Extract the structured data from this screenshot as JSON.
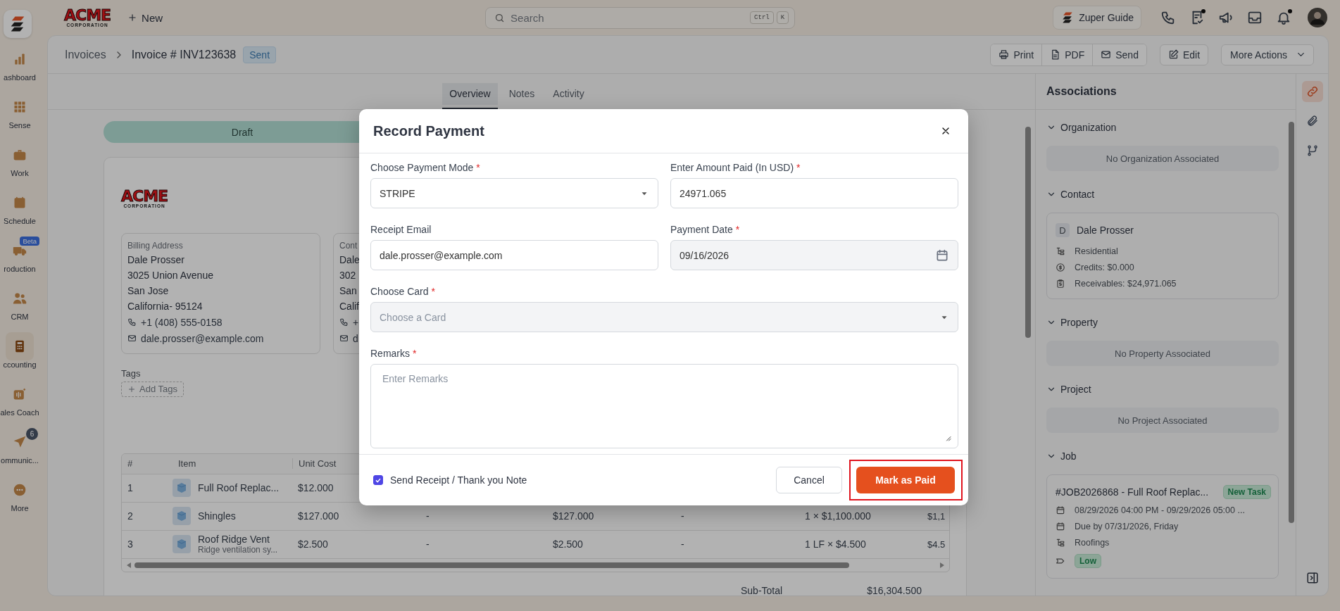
{
  "rail": {
    "items": [
      {
        "label": "ashboard",
        "selected": false
      },
      {
        "label": "Sense",
        "selected": false
      },
      {
        "label": "Work",
        "selected": false
      },
      {
        "label": "Schedule",
        "selected": false
      },
      {
        "label": "roduction",
        "selected": false,
        "badge": "Beta"
      },
      {
        "label": "CRM",
        "selected": false
      },
      {
        "label": "ccounting",
        "selected": true
      },
      {
        "label": "ales Coach",
        "selected": false
      },
      {
        "label": "ommunic...",
        "selected": false,
        "count": "6"
      },
      {
        "label": "More",
        "selected": false
      }
    ]
  },
  "topbar": {
    "brand": {
      "name": "ACME",
      "sub": "CORPORATION"
    },
    "new_button": "New",
    "search": {
      "placeholder": "Search",
      "shortcut": [
        "Ctrl",
        "K"
      ]
    },
    "guide_button": "Zuper Guide",
    "icons": [
      {
        "dot": false
      },
      {
        "dot": true
      },
      {
        "dot": false
      },
      {
        "dot": false
      },
      {
        "dot": true
      }
    ]
  },
  "breadcrumb": {
    "parent": "Invoices",
    "current": "Invoice # INV123638",
    "status": "Sent"
  },
  "actions": {
    "group": [
      "Print",
      "PDF",
      "Send"
    ],
    "edit": "Edit",
    "more": "More Actions"
  },
  "tabs": [
    {
      "label": "Overview",
      "selected": true
    },
    {
      "label": "Notes",
      "selected": false
    },
    {
      "label": "Activity",
      "selected": false
    }
  ],
  "invoice": {
    "stage": "Draft",
    "brand": {
      "name": "ACME",
      "sub": "CORPORATION"
    },
    "addresses": [
      {
        "title": "Billing Address",
        "lines": [
          "Dale Prosser",
          "3025 Union Avenue",
          "San Jose",
          "California- 95124"
        ],
        "phone": "+1 (408) 555-0158",
        "email": "dale.prosser@example.com"
      },
      {
        "title": "Cont",
        "lines": [
          "Dale",
          "302",
          "San",
          "Calif"
        ],
        "phone": "+",
        "email": "d"
      }
    ],
    "tags_label": "Tags",
    "add_tags": "Add Tags",
    "table": {
      "columns": [
        "#",
        "Item",
        "Unit Cost"
      ],
      "rows": [
        {
          "cells": [
            "1",
            "Full Roof Replac...",
            "$12.000"
          ]
        },
        {
          "cells": [
            "2",
            "Shingles",
            "$127.000",
            "-",
            "$127.000",
            "-",
            "1 × $1,100.000",
            "$1,1"
          ]
        },
        {
          "cells": [
            "3",
            "Roof Ridge Vent",
            "$2.500",
            "-",
            "$2.500",
            "-",
            "1 LF × $4.500",
            "$4.5"
          ],
          "note": "Ridge ventilation sy..."
        }
      ]
    },
    "subtotal_label": "Sub-Total",
    "subtotal": "$16,304.500"
  },
  "associations": {
    "title": "Associations",
    "sections": [
      {
        "title": "Organization",
        "expanded": true,
        "empty": "No Organization Associated"
      },
      {
        "title": "Contact",
        "expanded": true,
        "contact": {
          "initial": "D",
          "name": "Dale Prosser",
          "details": [
            "Residential",
            "Credits: $0.000",
            "Receivables: $24,971.065"
          ]
        }
      },
      {
        "title": "Property",
        "expanded": true,
        "empty": "No Property Associated"
      },
      {
        "title": "Project",
        "expanded": true,
        "empty": "No Project Associated"
      },
      {
        "title": "Job",
        "expanded": true,
        "job": {
          "title": "#JOB2026868 - Full Roof Replac...",
          "status": "New Task",
          "details": [
            "08/29/2026 04:00 PM - 09/29/2026 05:00 ...",
            "Due by 07/31/2026, Friday",
            "Roofings"
          ],
          "priority": "Low"
        }
      }
    ]
  },
  "side_tools": [
    {
      "selected": true
    },
    {
      "selected": false
    },
    {
      "selected": false
    }
  ],
  "modal": {
    "title": "Record Payment",
    "required_mark": "*",
    "rows": [
      [
        {
          "kind": "select",
          "label": "Choose Payment Mode",
          "required": true,
          "value": "STRIPE",
          "disabled": false
        },
        {
          "kind": "text",
          "label": "Enter Amount Paid (In USD)",
          "required": true,
          "value": "24971.065",
          "disabled": false
        }
      ],
      [
        {
          "kind": "text",
          "label": "Receipt Email",
          "required": false,
          "value": "dale.prosser@example.com",
          "disabled": false
        },
        {
          "kind": "date",
          "label": "Payment Date",
          "required": true,
          "value": "09/16/2026",
          "disabled": true
        }
      ],
      [
        {
          "kind": "select",
          "label": "Choose Card",
          "required": true,
          "placeholder": "Choose a Card",
          "disabled": true
        }
      ],
      [
        {
          "kind": "textarea",
          "label": "Remarks",
          "required": true,
          "placeholder": "Enter Remarks",
          "disabled": false
        }
      ]
    ],
    "send_receipt": {
      "label": "Send Receipt / Thank you Note",
      "checked": true
    },
    "cancel": "Cancel",
    "confirm": {
      "label": "Mark as Paid",
      "highlighted": true
    }
  }
}
